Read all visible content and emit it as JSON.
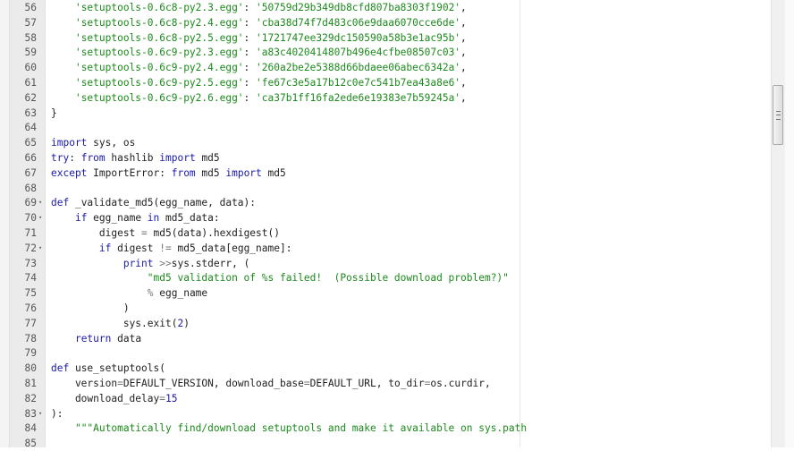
{
  "editor": {
    "lines": [
      {
        "n": "56",
        "fold": false,
        "t": [
          [
            "",
            "    "
          ],
          [
            "str",
            "'setuptools-0.6c8-py2.3.egg'"
          ],
          [
            "",
            ": "
          ],
          [
            "str",
            "'50759d29b349db8cfd807ba8303f1902'"
          ],
          [
            "",
            ","
          ]
        ]
      },
      {
        "n": "57",
        "fold": false,
        "t": [
          [
            "",
            "    "
          ],
          [
            "str",
            "'setuptools-0.6c8-py2.4.egg'"
          ],
          [
            "",
            ": "
          ],
          [
            "str",
            "'cba38d74f7d483c06e9daa6070cce6de'"
          ],
          [
            "",
            ","
          ]
        ]
      },
      {
        "n": "58",
        "fold": false,
        "t": [
          [
            "",
            "    "
          ],
          [
            "str",
            "'setuptools-0.6c8-py2.5.egg'"
          ],
          [
            "",
            ": "
          ],
          [
            "str",
            "'1721747ee329dc150590a58b3e1ac95b'"
          ],
          [
            "",
            ","
          ]
        ]
      },
      {
        "n": "59",
        "fold": false,
        "t": [
          [
            "",
            "    "
          ],
          [
            "str",
            "'setuptools-0.6c9-py2.3.egg'"
          ],
          [
            "",
            ": "
          ],
          [
            "str",
            "'a83c4020414807b496e4cfbe08507c03'"
          ],
          [
            "",
            ","
          ]
        ]
      },
      {
        "n": "60",
        "fold": false,
        "t": [
          [
            "",
            "    "
          ],
          [
            "str",
            "'setuptools-0.6c9-py2.4.egg'"
          ],
          [
            "",
            ": "
          ],
          [
            "str",
            "'260a2be2e5388d66bdaee06abec6342a'"
          ],
          [
            "",
            ","
          ]
        ]
      },
      {
        "n": "61",
        "fold": false,
        "t": [
          [
            "",
            "    "
          ],
          [
            "str",
            "'setuptools-0.6c9-py2.5.egg'"
          ],
          [
            "",
            ": "
          ],
          [
            "str",
            "'fe67c3e5a17b12c0e7c541b7ea43a8e6'"
          ],
          [
            "",
            ","
          ]
        ]
      },
      {
        "n": "62",
        "fold": false,
        "t": [
          [
            "",
            "    "
          ],
          [
            "str",
            "'setuptools-0.6c9-py2.6.egg'"
          ],
          [
            "",
            ": "
          ],
          [
            "str",
            "'ca37b1ff16fa2ede6e19383e7b59245a'"
          ],
          [
            "",
            ","
          ]
        ]
      },
      {
        "n": "63",
        "fold": false,
        "t": [
          [
            "",
            "}"
          ]
        ]
      },
      {
        "n": "64",
        "fold": false,
        "t": []
      },
      {
        "n": "65",
        "fold": false,
        "t": [
          [
            "kw",
            "import"
          ],
          [
            "",
            " sys, os"
          ]
        ]
      },
      {
        "n": "66",
        "fold": false,
        "t": [
          [
            "kw",
            "try"
          ],
          [
            "",
            ": "
          ],
          [
            "kw",
            "from"
          ],
          [
            "",
            " hashlib "
          ],
          [
            "kw",
            "import"
          ],
          [
            "",
            " md5"
          ]
        ]
      },
      {
        "n": "67",
        "fold": false,
        "t": [
          [
            "kw",
            "except"
          ],
          [
            "",
            " ImportError: "
          ],
          [
            "kw",
            "from"
          ],
          [
            "",
            " md5 "
          ],
          [
            "kw",
            "import"
          ],
          [
            "",
            " md5"
          ]
        ]
      },
      {
        "n": "68",
        "fold": false,
        "t": []
      },
      {
        "n": "69",
        "fold": true,
        "t": [
          [
            "kw",
            "def"
          ],
          [
            "",
            " _validate_md5(egg_name, data):"
          ]
        ]
      },
      {
        "n": "70",
        "fold": true,
        "t": [
          [
            "",
            "    "
          ],
          [
            "kw",
            "if"
          ],
          [
            "",
            " egg_name "
          ],
          [
            "kw",
            "in"
          ],
          [
            "",
            " md5_data:"
          ]
        ]
      },
      {
        "n": "71",
        "fold": false,
        "t": [
          [
            "",
            "        digest "
          ],
          [
            "op",
            "="
          ],
          [
            "",
            " md5(data).hexdigest()"
          ]
        ]
      },
      {
        "n": "72",
        "fold": true,
        "t": [
          [
            "",
            "        "
          ],
          [
            "kw",
            "if"
          ],
          [
            "",
            " digest "
          ],
          [
            "op",
            "!="
          ],
          [
            "",
            " md5_data[egg_name]:"
          ]
        ]
      },
      {
        "n": "73",
        "fold": false,
        "t": [
          [
            "",
            "            "
          ],
          [
            "kw",
            "print"
          ],
          [
            "",
            " "
          ],
          [
            "op",
            ">>"
          ],
          [
            "",
            "sys.stderr, ("
          ]
        ]
      },
      {
        "n": "74",
        "fold": false,
        "t": [
          [
            "",
            "                "
          ],
          [
            "str",
            "\"md5 validation of %s failed!  (Possible download problem?)\""
          ]
        ]
      },
      {
        "n": "75",
        "fold": false,
        "t": [
          [
            "",
            "                "
          ],
          [
            "op",
            "%"
          ],
          [
            "",
            " egg_name"
          ]
        ]
      },
      {
        "n": "76",
        "fold": false,
        "t": [
          [
            "",
            "            )"
          ]
        ]
      },
      {
        "n": "77",
        "fold": false,
        "t": [
          [
            "",
            "            sys.exit("
          ],
          [
            "num",
            "2"
          ],
          [
            "",
            ")"
          ]
        ]
      },
      {
        "n": "78",
        "fold": false,
        "t": [
          [
            "",
            "    "
          ],
          [
            "kw",
            "return"
          ],
          [
            "",
            " data"
          ]
        ]
      },
      {
        "n": "79",
        "fold": false,
        "t": []
      },
      {
        "n": "80",
        "fold": false,
        "t": [
          [
            "kw",
            "def"
          ],
          [
            "",
            " use_setuptools("
          ]
        ]
      },
      {
        "n": "81",
        "fold": false,
        "t": [
          [
            "",
            "    version"
          ],
          [
            "op",
            "="
          ],
          [
            "",
            "DEFAULT_VERSION, download_base"
          ],
          [
            "op",
            "="
          ],
          [
            "",
            "DEFAULT_URL, to_dir"
          ],
          [
            "op",
            "="
          ],
          [
            "",
            "os.curdir,"
          ]
        ]
      },
      {
        "n": "82",
        "fold": false,
        "t": [
          [
            "",
            "    download_delay"
          ],
          [
            "op",
            "="
          ],
          [
            "num",
            "15"
          ]
        ]
      },
      {
        "n": "83",
        "fold": true,
        "t": [
          [
            "",
            "):"
          ]
        ]
      },
      {
        "n": "84",
        "fold": false,
        "t": [
          [
            "",
            "    "
          ],
          [
            "str",
            "\"\"\"Automatically find/download setuptools and make it available on sys.path"
          ]
        ]
      },
      {
        "n": "85",
        "fold": false,
        "t": []
      }
    ],
    "scroll_position": 0.2
  }
}
